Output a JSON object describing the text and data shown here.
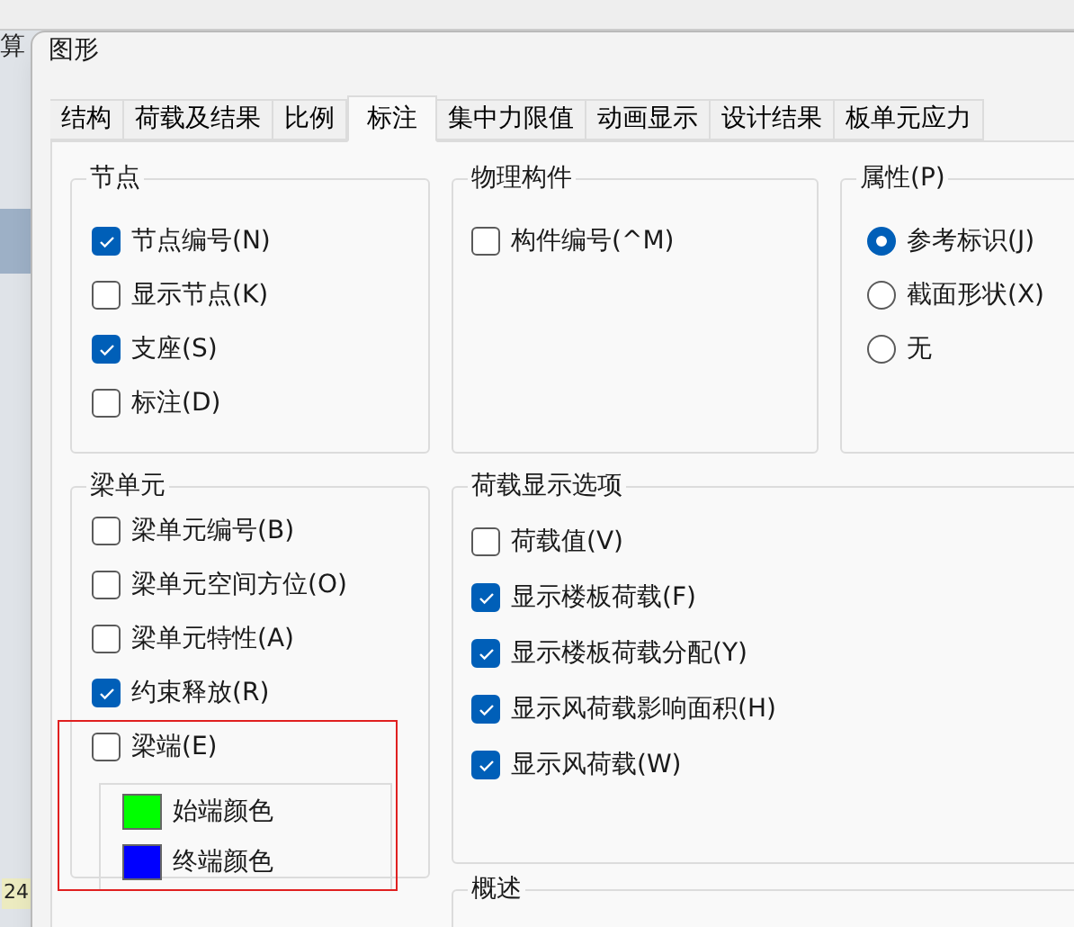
{
  "background_app": {
    "top_left_label": "算",
    "badge": "24"
  },
  "window": {
    "title": "图形"
  },
  "tabs": [
    {
      "label": "结构",
      "selected": false
    },
    {
      "label": "荷载及结果",
      "selected": false
    },
    {
      "label": "比例",
      "selected": false
    },
    {
      "label": "标注",
      "selected": true
    },
    {
      "label": "集中力限值",
      "selected": false
    },
    {
      "label": "动画显示",
      "selected": false
    },
    {
      "label": "设计结果",
      "selected": false
    },
    {
      "label": "板单元应力",
      "selected": false
    }
  ],
  "nodes": {
    "title": "节点",
    "items": [
      {
        "label": "节点编号(N)",
        "checked": true
      },
      {
        "label": "显示节点(K)",
        "checked": false
      },
      {
        "label": "支座(S)",
        "checked": true
      },
      {
        "label": "标注(D)",
        "checked": false
      }
    ]
  },
  "physical_members": {
    "title": "物理构件",
    "items": [
      {
        "label": "构件编号(^M)",
        "checked": false
      }
    ]
  },
  "properties": {
    "title": "属性(P)",
    "options": [
      {
        "label": "参考标识(J)",
        "selected": true
      },
      {
        "label": "截面形状(X)",
        "selected": false
      },
      {
        "label": "无",
        "selected": false
      }
    ]
  },
  "beam_elements": {
    "title": "梁单元",
    "items": [
      {
        "label": "梁单元编号(B)",
        "checked": false
      },
      {
        "label": "梁单元空间方位(O)",
        "checked": false
      },
      {
        "label": "梁单元特性(A)",
        "checked": false
      },
      {
        "label": "约束释放(R)",
        "checked": true
      },
      {
        "label": "梁端(E)",
        "checked": false
      }
    ],
    "end_colors": [
      {
        "label": "始端颜色",
        "color": "#00ff00"
      },
      {
        "label": "终端颜色",
        "color": "#0000ff"
      }
    ]
  },
  "load_display_options": {
    "title": "荷载显示选项",
    "items": [
      {
        "label": "荷载值(V)",
        "checked": false
      },
      {
        "label": "显示楼板荷载(F)",
        "checked": true
      },
      {
        "label": "显示楼板荷载分配(Y)",
        "checked": true
      },
      {
        "label": "显示风荷载影响面积(H)",
        "checked": true
      },
      {
        "label": "显示风荷载(W)",
        "checked": true
      }
    ]
  },
  "overview": {
    "title": "概述"
  }
}
